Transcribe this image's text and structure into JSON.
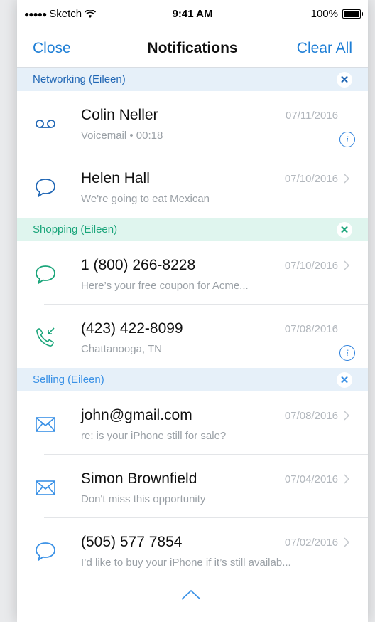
{
  "status_bar": {
    "carrier": "Sketch",
    "time": "9:41 AM",
    "battery": "100%"
  },
  "nav": {
    "left_label": "Close",
    "title": "Notifications",
    "right_label": "Clear All"
  },
  "colors": {
    "accent": "#1f7fd6",
    "networking": "#2167b5",
    "shopping": "#1aa57a",
    "selling": "#3a91e6"
  },
  "sections": [
    {
      "name": "Networking",
      "owner": "(Eileen)",
      "items": [
        {
          "name": "Colin Neller",
          "sub": "Voicemail • 00:18",
          "date": "07/11/2016",
          "icon": "voicemail-icon",
          "action": "info"
        },
        {
          "name": "Helen Hall",
          "sub": "We're going to eat Mexican",
          "date": "07/10/2016",
          "icon": "chat-bubble-icon",
          "action": "chevron"
        }
      ]
    },
    {
      "name": "Shopping",
      "owner": "(Eileen)",
      "items": [
        {
          "name": "1 (800) 266-8228",
          "sub": "Here’s your free coupon for Acme...",
          "date": "07/10/2016",
          "icon": "chat-bubble-icon",
          "action": "chevron"
        },
        {
          "name": "(423) 422-8099",
          "sub": "Chattanooga, TN",
          "date": "07/08/2016",
          "icon": "missed-call-icon",
          "action": "info"
        }
      ]
    },
    {
      "name": "Selling",
      "owner": "(Eileen)",
      "items": [
        {
          "name": "john@gmail.com",
          "sub": "re: is your iPhone still for sale?",
          "date": "07/08/2016",
          "icon": "mail-icon",
          "action": "chevron"
        },
        {
          "name": "Simon Brownfield",
          "sub": "Don't miss this opportunity",
          "date": "07/04/2016",
          "icon": "mail-icon",
          "action": "chevron"
        },
        {
          "name": "(505) 577 7854",
          "sub": "I’d like to buy your iPhone if it’s still availab...",
          "date": "07/02/2016",
          "icon": "chat-bubble-icon",
          "action": "chevron"
        }
      ]
    }
  ],
  "info_glyph": "i",
  "close_glyph": "✕"
}
